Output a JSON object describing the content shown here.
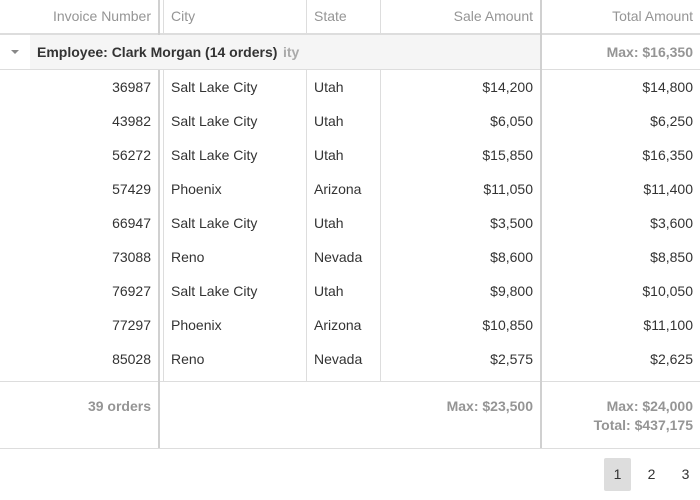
{
  "columns": {
    "invoice": "Invoice Number",
    "city": "City",
    "state": "State",
    "sale": "Sale Amount",
    "total": "Total Amount"
  },
  "group": {
    "label": "Employee: Clark Morgan (14 orders)",
    "ghost_text": "ity",
    "total_max": "Max: $16,350"
  },
  "rows": [
    {
      "invoice": "36987",
      "city": "Salt Lake City",
      "state": "Utah",
      "sale": "$14,200",
      "total": "$14,800"
    },
    {
      "invoice": "43982",
      "city": "Salt Lake City",
      "state": "Utah",
      "sale": "$6,050",
      "total": "$6,250"
    },
    {
      "invoice": "56272",
      "city": "Salt Lake City",
      "state": "Utah",
      "sale": "$15,850",
      "total": "$16,350"
    },
    {
      "invoice": "57429",
      "city": "Phoenix",
      "state": "Arizona",
      "sale": "$11,050",
      "total": "$11,400"
    },
    {
      "invoice": "66947",
      "city": "Salt Lake City",
      "state": "Utah",
      "sale": "$3,500",
      "total": "$3,600"
    },
    {
      "invoice": "73088",
      "city": "Reno",
      "state": "Nevada",
      "sale": "$8,600",
      "total": "$8,850"
    },
    {
      "invoice": "76927",
      "city": "Salt Lake City",
      "state": "Utah",
      "sale": "$9,800",
      "total": "$10,050"
    },
    {
      "invoice": "77297",
      "city": "Phoenix",
      "state": "Arizona",
      "sale": "$10,850",
      "total": "$11,100"
    },
    {
      "invoice": "85028",
      "city": "Reno",
      "state": "Nevada",
      "sale": "$2,575",
      "total": "$2,625"
    }
  ],
  "summary": {
    "orders": "39 orders",
    "sale_max": "Max: $23,500",
    "total_max": "Max: $24,000",
    "total_sum": "Total: $437,175"
  },
  "pager": {
    "pages": [
      "1",
      "2",
      "3"
    ],
    "active": "1"
  },
  "colors": {
    "header_text": "#959595",
    "border": "#dddddd",
    "group_bg": "#f5f5f5",
    "active_page_bg": "#dddddd"
  },
  "icons": {
    "group_toggle": "caret-down-icon"
  }
}
